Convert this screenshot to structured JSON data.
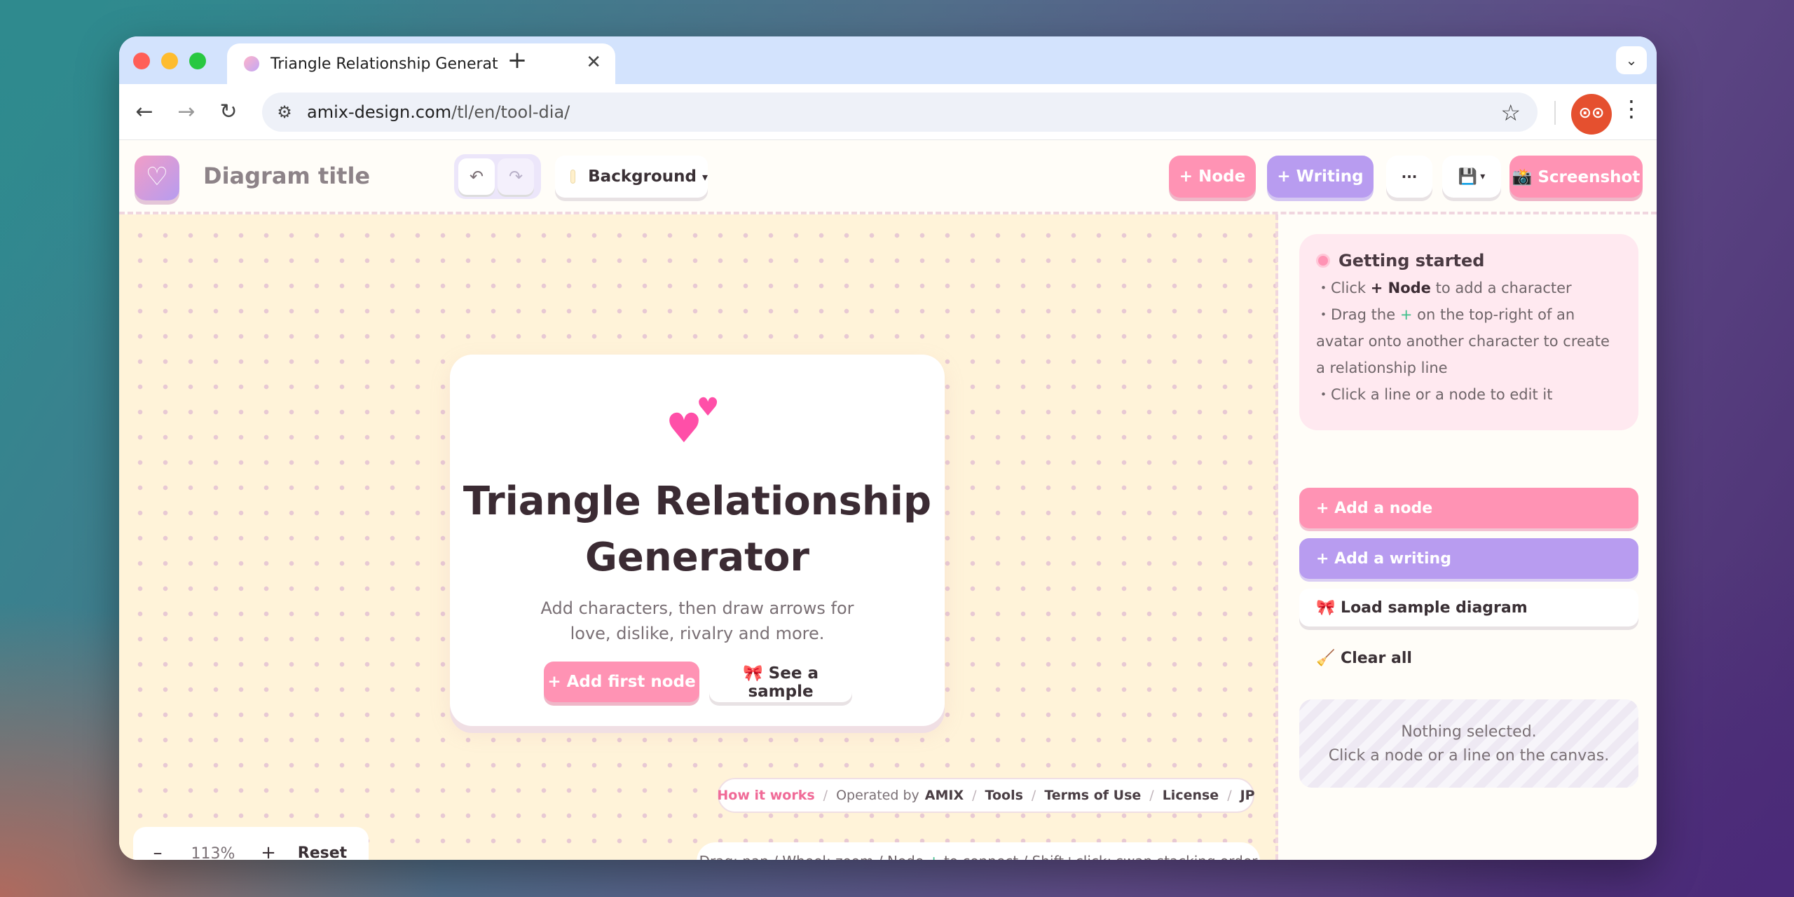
{
  "browser": {
    "tab_title": "Triangle Relationship Generat",
    "tab_close": "✕",
    "new_tab": "+",
    "url_host": "amix-design.com",
    "url_path": "/tl/en/tool-dia/",
    "avatar_glyph": "⊙⊙"
  },
  "header": {
    "diagram_title": "Diagram title",
    "undo_icon": "↶",
    "redo_icon": "↷",
    "background_label": "Background",
    "background_caret": "▾",
    "node_button": "+ Node",
    "writing_button": "+ Writing",
    "more_button": "···",
    "save_icon": "💾",
    "save_caret": "▾",
    "screenshot_button": "📸 Screenshot"
  },
  "card": {
    "title": "Triangle Relationship Generator",
    "subtitle": "Add characters, then draw arrows for love, dislike, rivalry and more.",
    "add_first_node": "+ Add first node",
    "see_sample": "🎀 See a sample"
  },
  "footer_links": {
    "how_it_works": "How it works",
    "operated_by": "Operated by",
    "amix": "AMIX",
    "tools": "Tools",
    "terms": "Terms of Use",
    "license": "License",
    "jp": "JP"
  },
  "zoom": {
    "minus": "–",
    "value": "113%",
    "plus": "+",
    "reset": "Reset"
  },
  "hint": {
    "part1": "Drag: pan / Wheel: zoom / Node",
    "plus": "+",
    "part2": "to connect / Shift+click: swap stacking order"
  },
  "side": {
    "getting_started": "Getting started",
    "step1_a": "・Click",
    "step1_b": "+ Node",
    "step1_c": "to add a character",
    "step2_a": "・Drag the",
    "step2_b": "+",
    "step2_c": "on the top-right of an avatar onto another character to create a relationship line",
    "step3": "・Click a line or a node to edit it",
    "add_node": "+ Add a node",
    "add_writing": "+ Add a writing",
    "load_sample": "🎀 Load sample diagram",
    "clear_all": "🧹 Clear all",
    "empty_line1": "Nothing selected.",
    "empty_line2": "Click a node or a line on the canvas."
  },
  "colors": {
    "pink": "#ff93b4",
    "purple": "#b89cf0",
    "canvas_bg": "#fff3d9"
  }
}
